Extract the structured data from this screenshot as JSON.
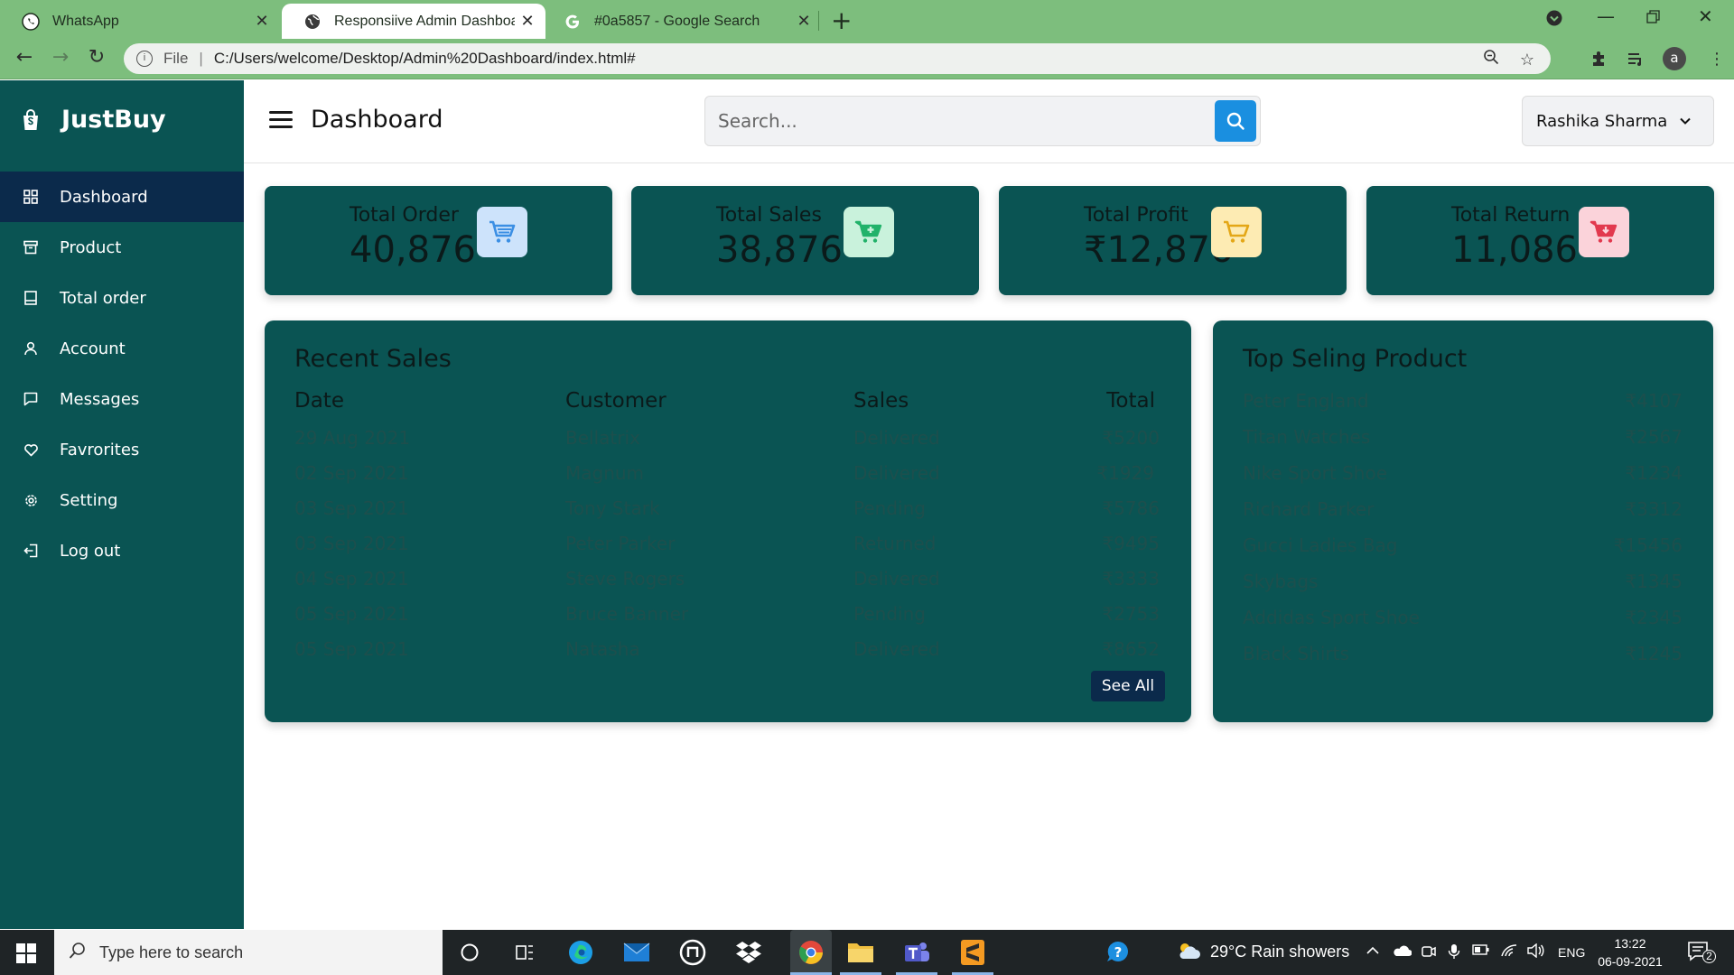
{
  "browser": {
    "tabs": [
      {
        "title": "WhatsApp",
        "icon": "whatsapp-icon",
        "active": false
      },
      {
        "title": "Responsiive Admin Dashboard | C",
        "icon": "globe-icon",
        "active": true
      },
      {
        "title": "#0a5857 - Google Search",
        "icon": "google-icon",
        "active": false
      }
    ],
    "omnibox": {
      "file_label": "File",
      "url": "C:/Users/welcome/Desktop/Admin%20Dashboard/index.html#"
    },
    "profile_initial": "a"
  },
  "sidebar": {
    "brand": "JustBuy",
    "items": [
      {
        "label": "Dashboard",
        "icon": "grid-icon",
        "active": true
      },
      {
        "label": "Product",
        "icon": "box-icon",
        "active": false
      },
      {
        "label": "Total order",
        "icon": "order-icon",
        "active": false
      },
      {
        "label": "Account",
        "icon": "user-icon",
        "active": false
      },
      {
        "label": "Messages",
        "icon": "message-icon",
        "active": false
      },
      {
        "label": "Favrorites",
        "icon": "heart-icon",
        "active": false
      },
      {
        "label": "Setting",
        "icon": "gear-icon",
        "active": false
      },
      {
        "label": "Log out",
        "icon": "logout-icon",
        "active": false
      }
    ]
  },
  "header": {
    "title": "Dashboard",
    "search_placeholder": "Search...",
    "user_name": "Rashika Sharma"
  },
  "stats": [
    {
      "label": "Total Order",
      "value": "40,876",
      "icon": "cart-icon",
      "icon_bg": "#cde3fb",
      "icon_color": "#3b8fe4"
    },
    {
      "label": "Total Sales",
      "value": "38,876",
      "icon": "cart-plus-icon",
      "icon_bg": "#c9f2dc",
      "icon_color": "#21b26a"
    },
    {
      "label": "Total Profit",
      "value": "₹12,876",
      "icon": "cart-icon",
      "icon_bg": "#fdebb3",
      "icon_color": "#e4a717"
    },
    {
      "label": "Total Return",
      "value": "11,086",
      "icon": "cart-return-icon",
      "icon_bg": "#fbd3da",
      "icon_color": "#e2394e"
    }
  ],
  "recent_sales": {
    "title": "Recent Sales",
    "columns": [
      "Date",
      "Customer",
      "Sales",
      "Total"
    ],
    "rows": [
      [
        "29 Aug 2021",
        "Bellatrix",
        "Delivered",
        "₹5200"
      ],
      [
        "02 Sep 2021",
        "Magnum",
        "Delivered",
        "₹1929"
      ],
      [
        "03 Sep 2021",
        "Tony Stark",
        "Pending",
        "₹5786"
      ],
      [
        "03 Sep 2021",
        "Peter Parker",
        "Returned",
        "₹9495"
      ],
      [
        "04 Sep 2021",
        "Steve Rogers",
        "Delivered",
        "₹3333"
      ],
      [
        "05 Sep 2021",
        "Bruce Banner",
        "Pending",
        "₹2753"
      ],
      [
        "05 Sep 2021",
        "Natasha",
        "Delivered",
        "₹8652"
      ]
    ],
    "see_all": "See All"
  },
  "top_products": {
    "title": "Top Seling Product",
    "items": [
      {
        "name": "Peter England",
        "price": "₹4107"
      },
      {
        "name": "Titan Watches",
        "price": "₹2567"
      },
      {
        "name": "Nike Sport Shoe",
        "price": "₹1234"
      },
      {
        "name": "Richard Parker",
        "price": "₹3312"
      },
      {
        "name": "Gucci Ladies Bag",
        "price": "₹15456"
      },
      {
        "name": "Skybags",
        "price": "₹1345"
      },
      {
        "name": "Addidas Sport Shoe",
        "price": "₹2345"
      },
      {
        "name": "Black Shirts",
        "price": "₹1245"
      }
    ]
  },
  "taskbar": {
    "search_placeholder": "Type here to search",
    "weather": "29°C  Rain showers",
    "language": "ENG",
    "time": "13:22",
    "date": "06-09-2021",
    "notification_count": "2"
  },
  "colors": {
    "accent": "#0a5453",
    "active_nav": "#0b2a4b",
    "search_button": "#1a8fe0",
    "browser_chrome": "#7dbe7d"
  }
}
